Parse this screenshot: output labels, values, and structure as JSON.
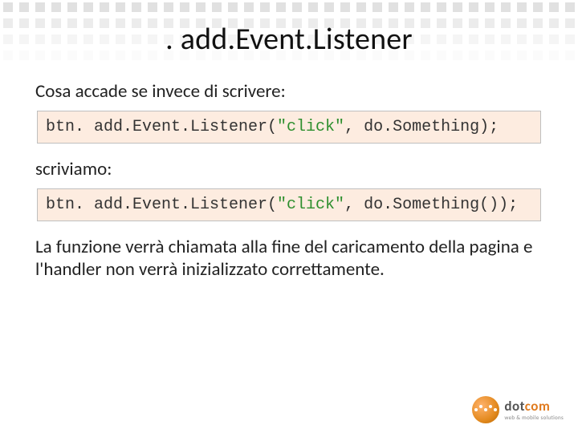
{
  "title": ". add.Event.Listener",
  "intro": "Cosa accade se invece di scrivere:",
  "code1": {
    "prefix": "btn. add.Event.Listener(",
    "str": "\"click\"",
    "suffix": ", do.Something);"
  },
  "mid": "scriviamo:",
  "code2": {
    "prefix": "btn. add.Event.Listener(",
    "str": "\"click\"",
    "suffix": ", do.Something());"
  },
  "closing": "La funzione verrà chiamata alla fine del caricamento della pagina e l'handler non verrà inizializzato correttamente.",
  "logo": {
    "brand_part1": "dot",
    "brand_part2": "com",
    "tagline": "web & mobile solutions"
  }
}
